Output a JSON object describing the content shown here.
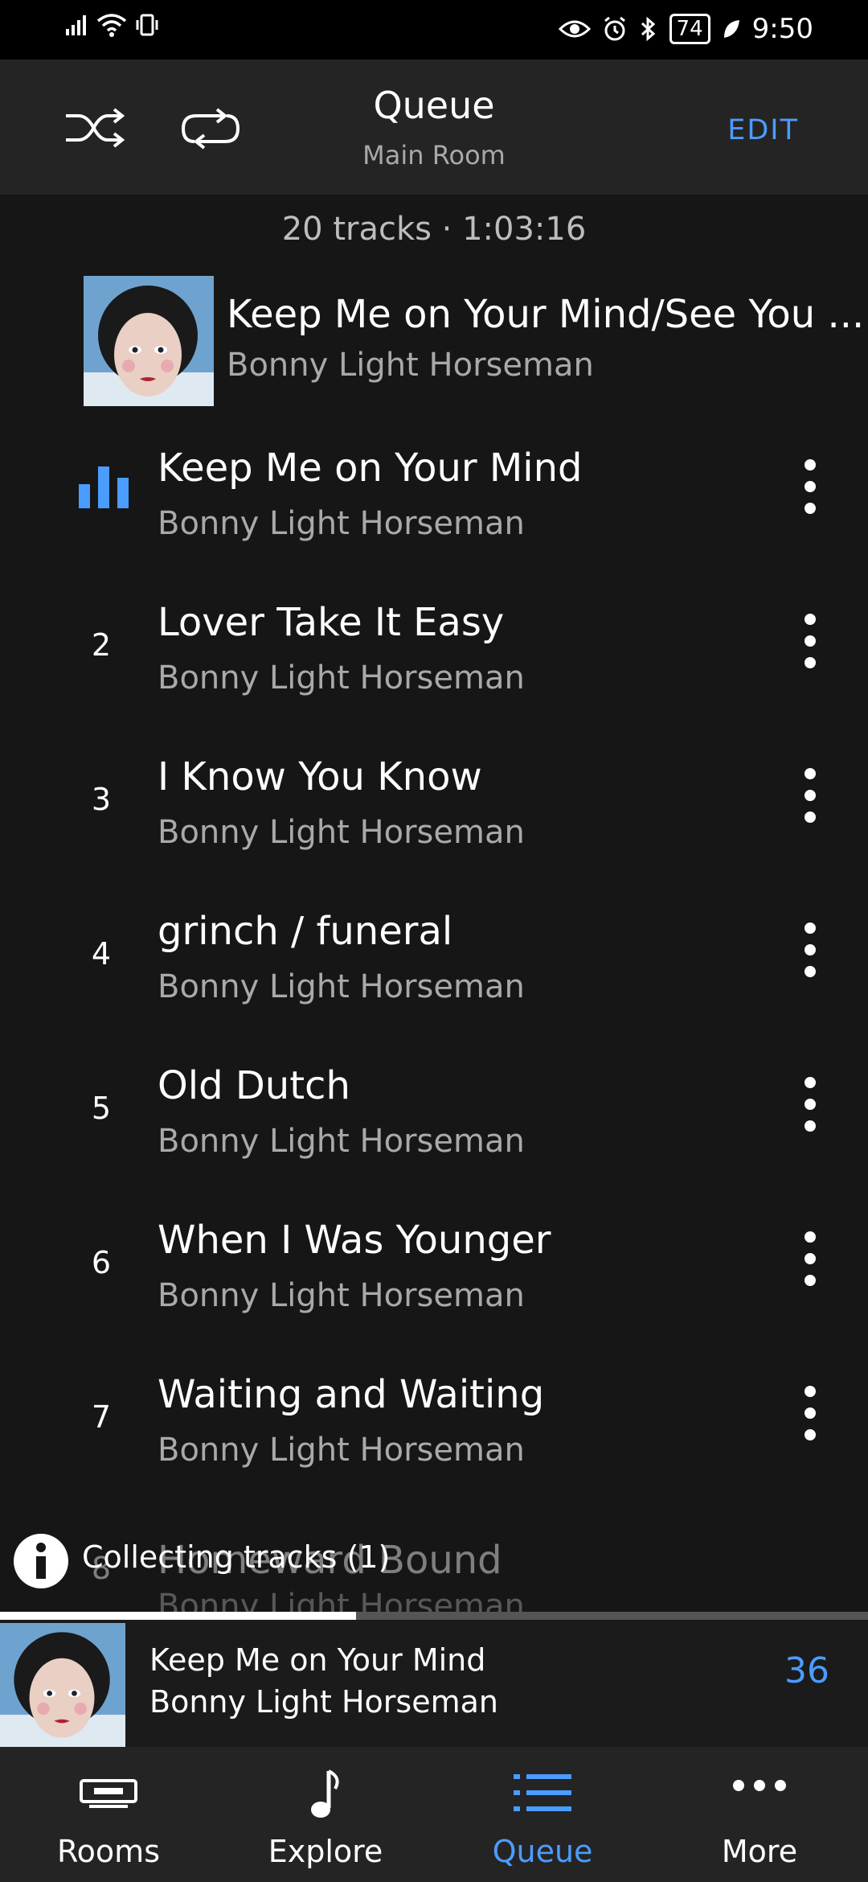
{
  "status_bar": {
    "battery": "74",
    "time": "9:50"
  },
  "header": {
    "title": "Queue",
    "subtitle": "Main Room",
    "edit_label": "EDIT"
  },
  "summary": "20 tracks · 1:03:16",
  "album": {
    "title": "Keep Me on Your Mind/See You ...",
    "artist": "Bonny Light Horseman"
  },
  "tracks": [
    {
      "num": "",
      "title": "Keep Me on Your Mind",
      "artist": "Bonny Light Horseman",
      "playing": true
    },
    {
      "num": "2",
      "title": "Lover Take It Easy",
      "artist": "Bonny Light Horseman"
    },
    {
      "num": "3",
      "title": "I Know You Know",
      "artist": "Bonny Light Horseman"
    },
    {
      "num": "4",
      "title": "grinch / funeral",
      "artist": "Bonny Light Horseman"
    },
    {
      "num": "5",
      "title": "Old Dutch",
      "artist": "Bonny Light Horseman"
    },
    {
      "num": "6",
      "title": "When I Was Younger",
      "artist": "Bonny Light Horseman"
    },
    {
      "num": "7",
      "title": "Waiting and Waiting",
      "artist": "Bonny Light Horseman"
    },
    {
      "num": "8",
      "title": "Homeward Bound",
      "artist": "Bonny Light Horseman"
    }
  ],
  "toast": {
    "text": "Collecting tracks (1)"
  },
  "now_playing": {
    "title": "Keep Me on Your Mind",
    "artist": "Bonny Light Horseman",
    "volume": "36",
    "progress": 0.41
  },
  "tabs": [
    {
      "label": "Rooms",
      "icon": "rooms-icon"
    },
    {
      "label": "Explore",
      "icon": "music-note-icon"
    },
    {
      "label": "Queue",
      "icon": "queue-list-icon",
      "active": true
    },
    {
      "label": "More",
      "icon": "more-icon"
    }
  ],
  "colors": {
    "accent": "#4b9cff",
    "background": "#161616",
    "header": "#242424",
    "secondary_text": "#a9a9a9"
  }
}
